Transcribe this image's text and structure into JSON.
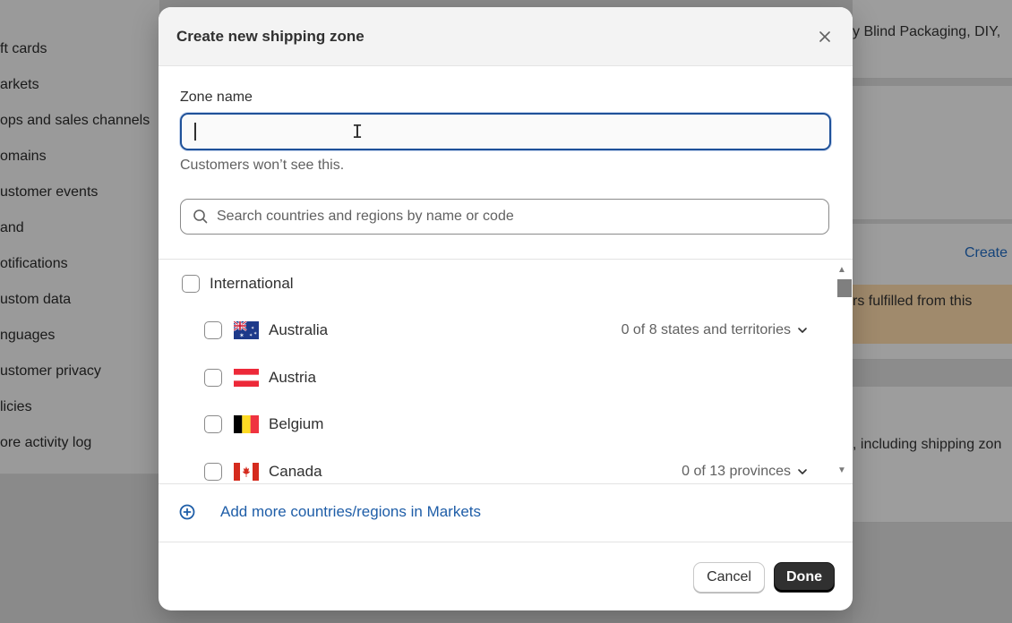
{
  "background": {
    "nav_items": [
      "ft cards",
      "arkets",
      "ops and sales channels",
      "omains",
      "ustomer events",
      "and",
      "otifications",
      "ustom data",
      "nguages",
      "ustomer privacy",
      "licies",
      "ore activity log"
    ],
    "right_text_top": "y Blind Packaging, DIY,",
    "create_link": "Create",
    "banner_text": "rs fulfilled from this",
    "right_text_bottom": ", including shipping zon"
  },
  "modal": {
    "title": "Create new shipping zone",
    "close_icon": "close-icon",
    "zone_name_label": "Zone name",
    "zone_name_value": "",
    "zone_name_help": "Customers won’t see this.",
    "search_placeholder": "Search countries and regions by name or code",
    "international_label": "International",
    "countries": [
      {
        "name": "Australia",
        "detail": "0 of 8 states and territories",
        "flag": "australia-flag-icon"
      },
      {
        "name": "Austria",
        "detail": "",
        "flag": "austria-flag-icon"
      },
      {
        "name": "Belgium",
        "detail": "",
        "flag": "belgium-flag-icon"
      },
      {
        "name": "Canada",
        "detail": "0 of 13 provinces",
        "flag": "canada-flag-icon"
      }
    ],
    "add_more_label": "Add more countries/regions in Markets",
    "cancel_label": "Cancel",
    "done_label": "Done"
  },
  "colors": {
    "accent": "#1f5199",
    "link": "#1f5ea8",
    "primary_button": "#303030"
  }
}
